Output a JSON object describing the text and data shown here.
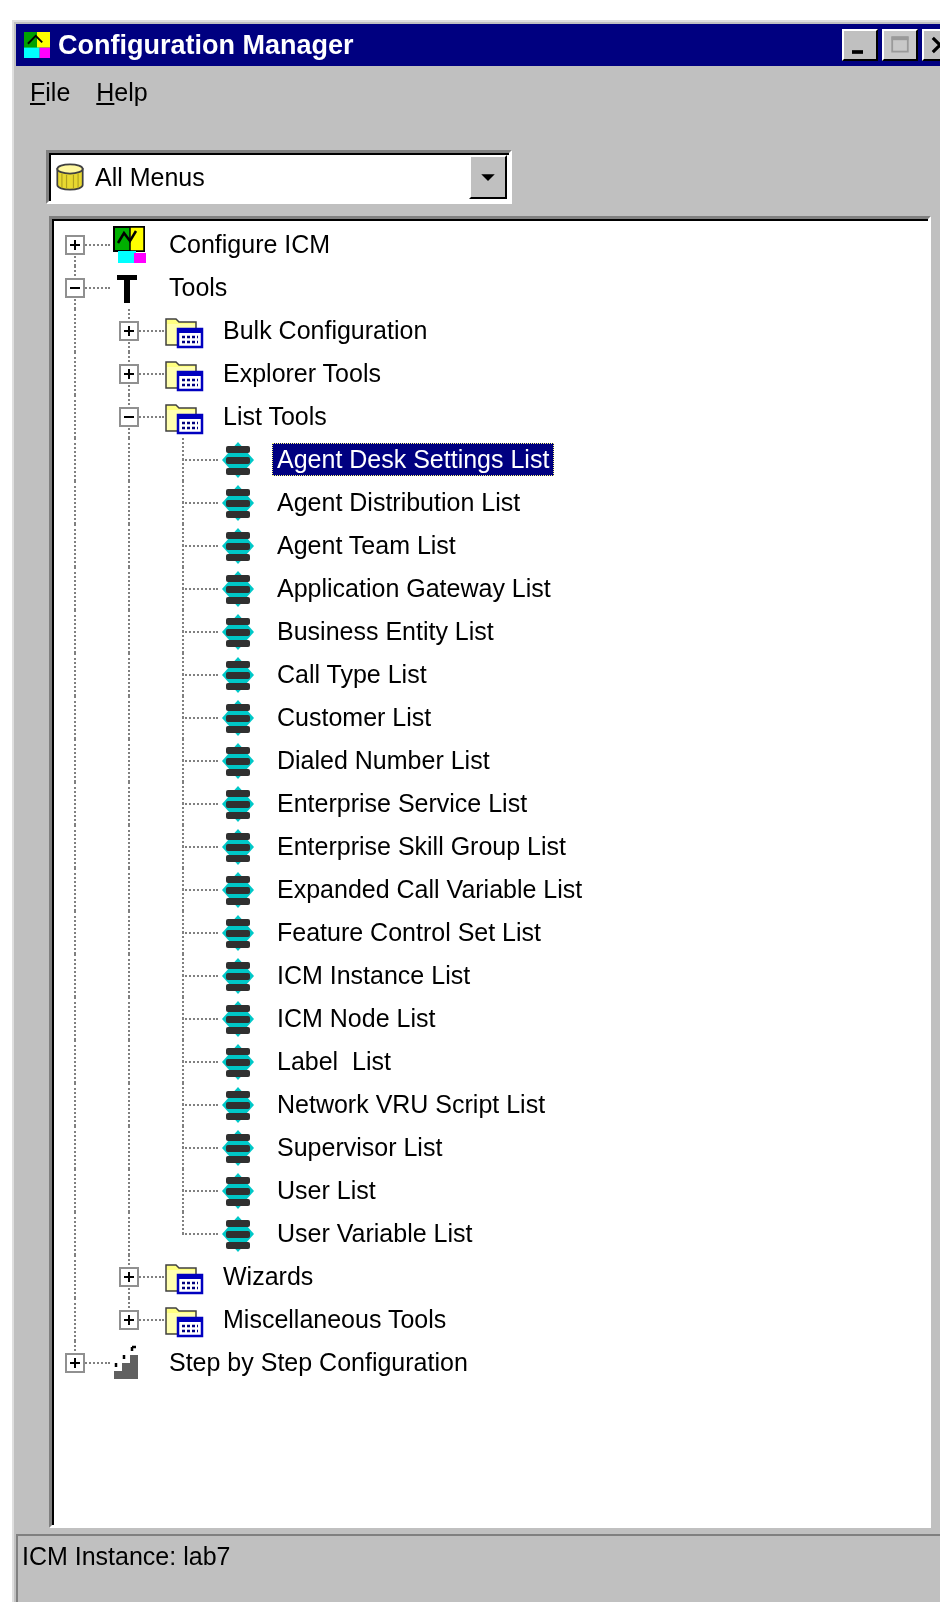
{
  "window": {
    "title": "Configuration Manager",
    "controls": [
      {
        "kind": "minimize",
        "disabled": false
      },
      {
        "kind": "maximize",
        "disabled": true
      },
      {
        "kind": "close",
        "disabled": false
      }
    ]
  },
  "menu": [
    "File",
    "Help"
  ],
  "combo": {
    "value": "All Menus"
  },
  "tree": {
    "items": [
      {
        "label": "Configure ICM",
        "kind": "module",
        "expanded": false,
        "selected": false
      },
      {
        "label": "Tools",
        "kind": "tools",
        "expanded": true,
        "selected": false,
        "children": [
          {
            "label": "Bulk Configuration",
            "kind": "folder",
            "expanded": false,
            "selected": false
          },
          {
            "label": "Explorer Tools",
            "kind": "folder",
            "expanded": false,
            "selected": false
          },
          {
            "label": "List Tools",
            "kind": "folder",
            "expanded": true,
            "selected": false,
            "children": [
              {
                "label": "Agent Desk Settings List",
                "kind": "list",
                "selected": true
              },
              {
                "label": "Agent Distribution List",
                "kind": "list",
                "selected": false
              },
              {
                "label": "Agent Team List",
                "kind": "list",
                "selected": false
              },
              {
                "label": "Application Gateway List",
                "kind": "list",
                "selected": false
              },
              {
                "label": "Business Entity List",
                "kind": "list",
                "selected": false
              },
              {
                "label": "Call Type List",
                "kind": "list",
                "selected": false
              },
              {
                "label": "Customer List",
                "kind": "list",
                "selected": false
              },
              {
                "label": "Dialed Number List",
                "kind": "list",
                "selected": false
              },
              {
                "label": "Enterprise Service List",
                "kind": "list",
                "selected": false
              },
              {
                "label": "Enterprise Skill Group List",
                "kind": "list",
                "selected": false
              },
              {
                "label": "Expanded Call Variable List",
                "kind": "list",
                "selected": false
              },
              {
                "label": "Feature Control Set List",
                "kind": "list",
                "selected": false
              },
              {
                "label": "ICM Instance List",
                "kind": "list",
                "selected": false
              },
              {
                "label": "ICM Node List",
                "kind": "list",
                "selected": false
              },
              {
                "label": "Label  List",
                "kind": "list",
                "selected": false
              },
              {
                "label": "Network VRU Script List",
                "kind": "list",
                "selected": false
              },
              {
                "label": "Supervisor List",
                "kind": "list",
                "selected": false
              },
              {
                "label": "User List",
                "kind": "list",
                "selected": false
              },
              {
                "label": "User Variable List",
                "kind": "list",
                "selected": false
              }
            ]
          },
          {
            "label": "Wizards",
            "kind": "folder",
            "expanded": false,
            "selected": false
          },
          {
            "label": "Miscellaneous Tools",
            "kind": "folder",
            "expanded": false,
            "selected": false
          }
        ]
      },
      {
        "label": "Step by Step Configuration",
        "kind": "steps",
        "expanded": false,
        "selected": false
      }
    ]
  },
  "status_bar": "ICM Instance: lab7"
}
